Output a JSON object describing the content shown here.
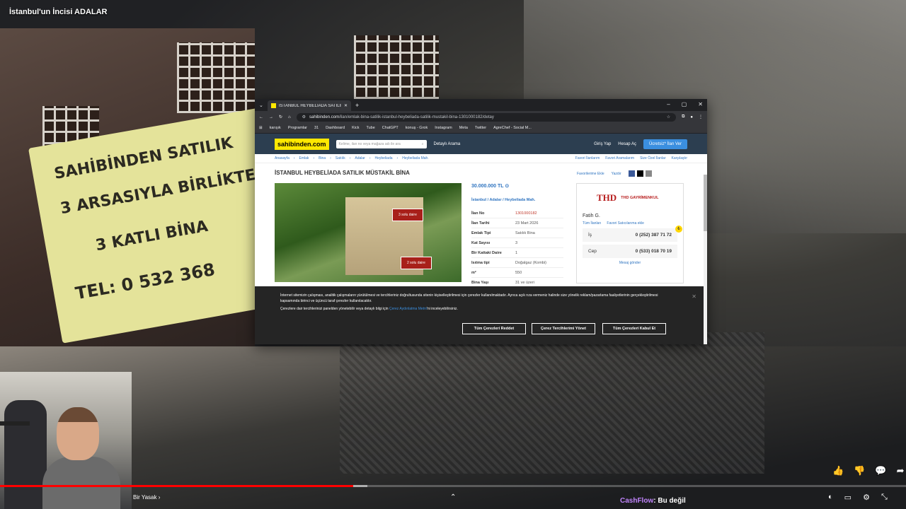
{
  "video": {
    "title": "İstanbul'un İncisi ADALAR",
    "chapter": "Bir Yasak",
    "progress": 0.39,
    "chat_user": "CashFlow",
    "chat_message": ": Bu değil"
  },
  "banner": {
    "line1": "SAHİBİNDEN SATILIK",
    "line2": "3 ARSASIYLA BİRLİKTE",
    "line3": "3 KATLI BİNA",
    "line4": "TEL: 0 532 368"
  },
  "browser": {
    "tab_title": "İSTANBUL HEYBELİADA SATILIK",
    "url_domain": "sahibinden.com",
    "url_path": "/ilan/emlak-bina-satilik-istanbul-heybeliada-satilik-mustakil-bina-1301000182/detay",
    "bookmarks": [
      "karışık",
      "Programlar",
      "31",
      "Dashboard",
      "Kick",
      "Tube",
      "ChatGPT",
      "konuş - Grok",
      "Instagram",
      "Meta",
      "Twitter",
      "AgreChef - Social M..."
    ]
  },
  "site": {
    "logo": "sahibinden.com",
    "search_placeholder": "Kelime, ilan no veya mağaza adı ile ara",
    "detailed_search": "Detaylı Arama",
    "login": "Giriş Yap",
    "signup": "Hesap Aç",
    "publish": "Ücretsiz* İlan Ver",
    "breadcrumbs": [
      "Anasayfa",
      "Emlak",
      "Bina",
      "Satılık",
      "Adalar",
      "Heybeliada",
      "Heybeliada Mah."
    ],
    "crumb_links": [
      "Favori İlanlarım",
      "Favori Aramalarım",
      "Size Özel İlanlar",
      "Karşılaştır"
    ],
    "listing_title": "İSTANBUL HEYBELİADA SATILIK MÜSTAKİL BİNA",
    "favorite": "Favorilerime Ekle",
    "print": "Yazdır",
    "photo_tag1": "3 solu daire",
    "photo_tag2": "2 solu daire",
    "price": "30.000.000 TL",
    "location": "İstanbul  /  Adalar  /  Heybeliada Mah.",
    "details": [
      {
        "k": "İlan No",
        "v": "1301000182"
      },
      {
        "k": "İlan Tarihi",
        "v": "23 Mart 2026"
      },
      {
        "k": "Emlak Tipi",
        "v": "Satılık Bina"
      },
      {
        "k": "Kat Sayısı",
        "v": "3"
      },
      {
        "k": "Bir Kattaki Daire",
        "v": "1"
      },
      {
        "k": "Isıtma tipi",
        "v": "Doğalgaz (Kombi)"
      },
      {
        "k": "m²",
        "v": "550"
      },
      {
        "k": "Bina Yaşı",
        "v": "31 ve üzeri"
      }
    ],
    "seller_logo": "THD",
    "seller_company": "THD GAYRİMENKUL",
    "seller_name": "Fatih G.",
    "seller_links": [
      "Tüm İlanları",
      "Favori Satıcılarıma ekle"
    ],
    "phones": [
      {
        "label": "İş",
        "number": "0 (252) 387 71 72"
      },
      {
        "label": "Cep",
        "number": "0 (533) 018 70 19"
      }
    ],
    "send_message": "Mesaj gönder"
  },
  "cookie": {
    "text1": "İnternet sitemizin çalışması, analitik çalışmaların yürütülmesi ve tercihleriniz doğrultusunda sitenin kişiselleştirilmesi için çerezler kullanılmaktadır. Ayrıca açık rıza vermeniz halinde size yönelik reklam/pazarlama faaliyetlerinin gerçekleştirilmesi kapsamında birinci ve üçüncü taraf çerezler kullanılacaktır.",
    "text2_pre": "Çerezlere dair tercihlerinizi panelden yönetebilir veya detaylı bilgi için ",
    "text2_link": "Çerez Aydınlatma Metni",
    "text2_post": "'ni inceleyebilirsiniz.",
    "reject": "Tüm Çerezleri Reddet",
    "manage": "Çerez Tercihlerimi Yönet",
    "accept": "Tüm Çerezleri Kabul Et"
  }
}
